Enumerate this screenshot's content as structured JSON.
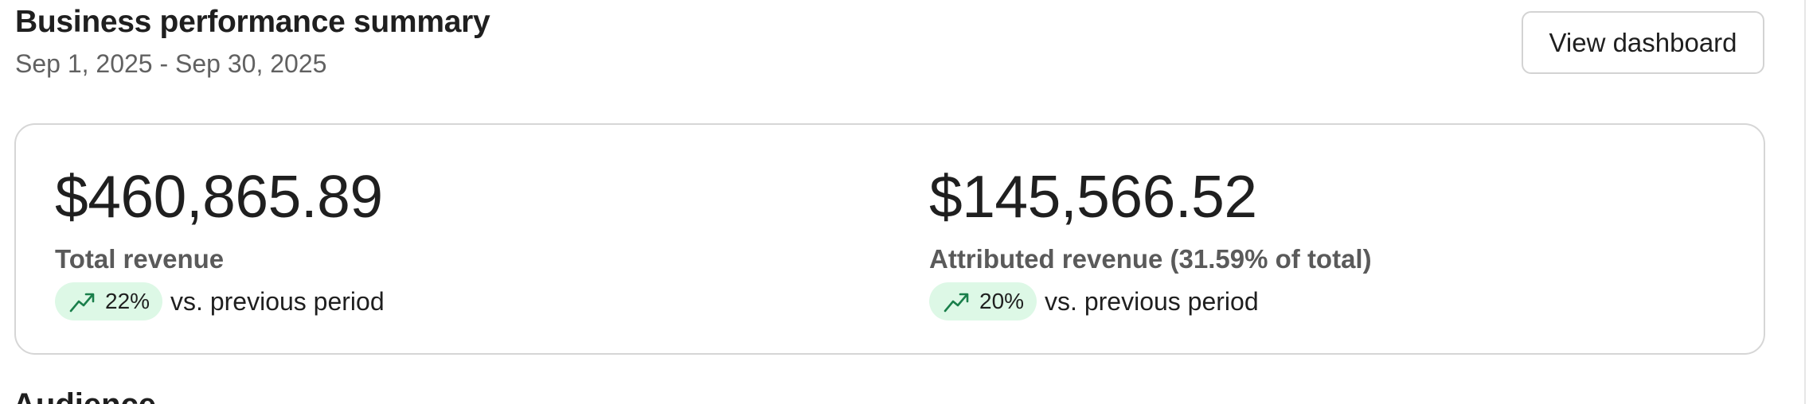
{
  "header": {
    "title": "Business performance summary",
    "date_range": "Sep 1, 2025 - Sep 30, 2025",
    "view_dashboard_label": "View dashboard"
  },
  "metrics": [
    {
      "value": "$460,865.89",
      "label": "Total revenue",
      "change": "22%",
      "change_icon": "trend-up-icon",
      "comparison": "vs. previous period"
    },
    {
      "value": "$145,566.52",
      "label": "Attributed revenue (31.59% of total)",
      "change": "20%",
      "change_icon": "trend-up-icon",
      "comparison": "vs. previous period"
    }
  ],
  "next_section": {
    "title": "Audience"
  },
  "colors": {
    "badge_bg": "#ddf8e6",
    "trend_green": "#1a7f4b",
    "text_primary": "#1f1f1f",
    "text_secondary": "#616161",
    "border": "#d6d6d6"
  }
}
